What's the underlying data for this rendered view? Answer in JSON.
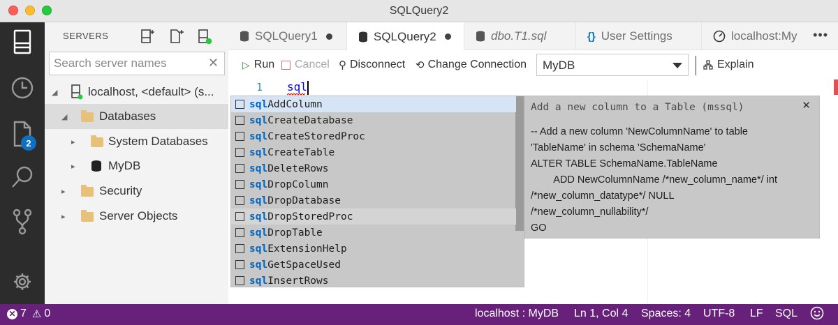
{
  "window": {
    "title": "SQLQuery2"
  },
  "activity": {
    "explorer_badge": "2"
  },
  "sidebar": {
    "header": "SERVERS",
    "search_placeholder": "Search server names",
    "tree": [
      {
        "label": "localhost, <default> (s...",
        "kind": "server",
        "expanded": true
      },
      {
        "label": "Databases",
        "kind": "folder",
        "expanded": true,
        "selected": true
      },
      {
        "label": "System Databases",
        "kind": "folder",
        "expanded": false
      },
      {
        "label": "MyDB",
        "kind": "database",
        "expanded": false
      },
      {
        "label": "Security",
        "kind": "folder",
        "expanded": false
      },
      {
        "label": "Server Objects",
        "kind": "folder",
        "expanded": false
      }
    ]
  },
  "tabs": [
    {
      "label": "SQLQuery1",
      "icon": "database-icon",
      "dirty": true,
      "active": false
    },
    {
      "label": "SQLQuery2",
      "icon": "database-icon",
      "dirty": true,
      "active": true
    },
    {
      "label": "dbo.T1.sql",
      "icon": "database-icon",
      "dirty": false,
      "active": false,
      "italic": true
    },
    {
      "label": "User Settings",
      "icon": "braces-icon",
      "dirty": false,
      "active": false
    },
    {
      "label": "localhost:My",
      "icon": "dashboard-icon",
      "dirty": false,
      "active": false
    }
  ],
  "toolbar": {
    "run": "Run",
    "cancel": "Cancel",
    "disconnect": "Disconnect",
    "change_connection": "Change Connection",
    "database": "MyDB",
    "explain": "Explain"
  },
  "editor": {
    "line_number": "1",
    "code": "sql"
  },
  "suggest": {
    "prefix": "sql",
    "items": [
      {
        "rest": "AddColumn"
      },
      {
        "rest": "CreateDatabase"
      },
      {
        "rest": "CreateStoredProc"
      },
      {
        "rest": "CreateTable"
      },
      {
        "rest": "DeleteRows"
      },
      {
        "rest": "DropColumn"
      },
      {
        "rest": "DropDatabase"
      },
      {
        "rest": "DropStoredProc"
      },
      {
        "rest": "DropTable"
      },
      {
        "rest": "ExtensionHelp"
      },
      {
        "rest": "GetSpaceUsed"
      },
      {
        "rest": "InsertRows"
      }
    ],
    "focused_index": 0,
    "hovered_index": 7
  },
  "details": {
    "title": "Add a new column to a Table (mssql)",
    "body": "-- Add a new column 'NewColumnName' to table\n'TableName' in schema 'SchemaName'\nALTER TABLE SchemaName.TableName\n        ADD NewColumnName /*new_column_name*/ int\n/*new_column_datatype*/ NULL\n/*new_column_nullability*/\nGO"
  },
  "status": {
    "errors": "7",
    "warnings": "0",
    "connection": "localhost : MyDB",
    "position": "Ln 1, Col 4",
    "spaces": "Spaces: 4",
    "encoding": "UTF-8",
    "eol": "LF",
    "language": "SQL"
  }
}
